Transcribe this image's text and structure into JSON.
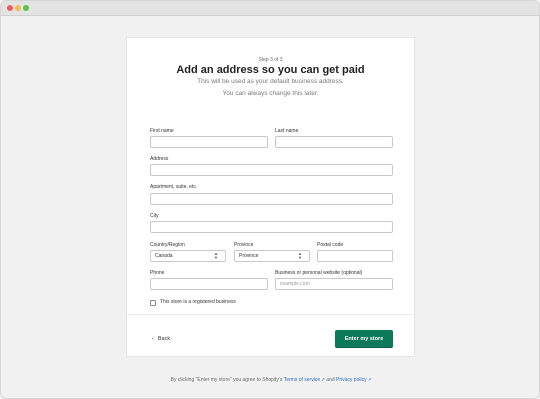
{
  "header": {
    "step": "Step 3 of 3",
    "title": "Add an address so you can get paid",
    "subtitle_line1": "This will be used as your default business address.",
    "subtitle_line2": "You can always change this later."
  },
  "form": {
    "first_name": {
      "label": "First name",
      "value": ""
    },
    "last_name": {
      "label": "Last name",
      "value": ""
    },
    "address": {
      "label": "Address",
      "value": ""
    },
    "apartment": {
      "label": "Apartment, suite, etc.",
      "value": ""
    },
    "city": {
      "label": "City",
      "value": ""
    },
    "country": {
      "label": "Country/Region",
      "value": "Canada"
    },
    "province": {
      "label": "Province",
      "value": "Province"
    },
    "postal": {
      "label": "Postal code",
      "value": ""
    },
    "phone": {
      "label": "Phone",
      "value": ""
    },
    "website": {
      "label": "Business or personal website (optional)",
      "placeholder": "example.com",
      "value": ""
    },
    "registered": {
      "label": "This store is a registered business",
      "checked": false
    }
  },
  "actions": {
    "back_label": "Back",
    "submit_label": "Enter my store"
  },
  "footer": {
    "prefix": "By clicking \"Enter my store\" you agree to Shopify's",
    "terms": "Terms of service",
    "and": "and",
    "privacy": "Privacy policy"
  },
  "icons": {
    "external_link": "external-link-icon",
    "chevron_left": "chevron-left-icon",
    "select_chevron": "select-chevron-icon"
  },
  "colors": {
    "primary": "#0c7a58",
    "link": "#2c6ecb"
  }
}
